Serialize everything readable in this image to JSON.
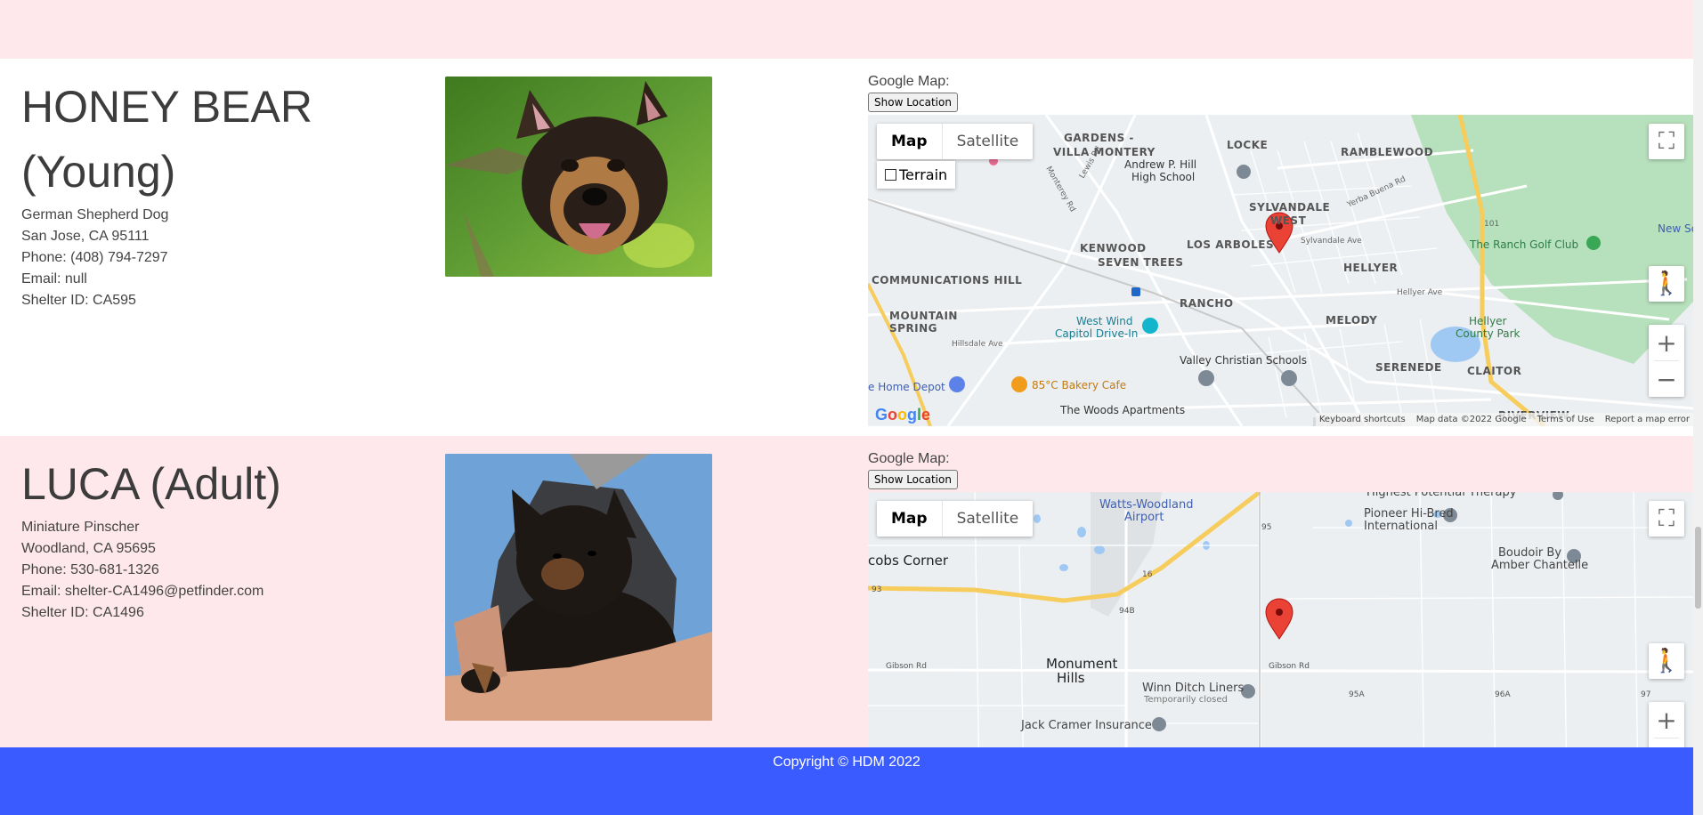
{
  "pets": [
    {
      "name": "HONEY BEAR",
      "age": "(Young)",
      "breed": "German Shepherd Dog",
      "location": "San Jose, CA 95111",
      "phone": "Phone: (408) 794-7297",
      "email": "Email: null",
      "shelter": "Shelter ID: CA595",
      "map_label": "Google Map:",
      "show_location": "Show Location",
      "map": {
        "map_button": "Map",
        "satellite_button": "Satellite",
        "terrain_label": "Terrain",
        "places": [
          "GARDENS -",
          "VILLA MONTERY",
          "LOCKE",
          "RAMBLEWOOD",
          "Andrew P. Hill",
          "High School",
          "SYLVANDALE",
          "WEST",
          "New Seas",
          "The Ranch Golf Club",
          "KENWOOD",
          "LOS ARBOLES",
          "SEVEN TREES",
          "HELLYER",
          "COMMUNICATIONS HILL",
          "RANCHO",
          "MOUNTAIN",
          "SPRING",
          "West Wind",
          "Capitol Drive-In",
          "MELODY",
          "Hellyer",
          "County Park",
          "Valley Christian Schools",
          "SERENEDE",
          "CLAITOR",
          "e Home Depot",
          "85°C Bakery Cafe",
          "The Woods Apartments",
          "RIVERVIEW",
          "Hillsdale Ave",
          "Hellyer Ave",
          "Sylvandale Ave",
          "Yerba Buena Rd",
          "Monterey Rd",
          "Lewis Rd",
          "101"
        ],
        "attribution": [
          "Keyboard shortcuts",
          "Map data ©2022 Google",
          "Terms of Use",
          "Report a map error"
        ]
      }
    },
    {
      "name": "LUCA (Adult)",
      "breed": "Miniature Pinscher",
      "location": "Woodland, CA 95695",
      "phone": "Phone: 530-681-1326",
      "email": "Email: shelter-CA1496@petfinder.com",
      "shelter": "Shelter ID: CA1496",
      "map_label": "Google Map:",
      "show_location": "Show Location",
      "map": {
        "map_button": "Map",
        "satellite_button": "Satellite",
        "places": [
          "Watts-Woodland",
          "Airport",
          "Highest Potential Therapy",
          "Pioneer Hi-Bred",
          "International",
          "Boudoir By",
          "Amber Chantelle",
          "cobs Corner",
          "Monument",
          "Hills",
          "Winn Ditch Liners",
          "Temporarily closed",
          "Jack Cramer Insurance",
          "Gibson Rd",
          "Gibson Rd",
          "16",
          "95",
          "93",
          "94B",
          "95A",
          "96A",
          "97"
        ]
      }
    }
  ],
  "footer": {
    "text": "Copyright © HDM 2022"
  },
  "colors": {
    "pink_band": "#ffe8ec",
    "footer_blue": "#3a5bff",
    "pin_red": "#ea4335"
  }
}
